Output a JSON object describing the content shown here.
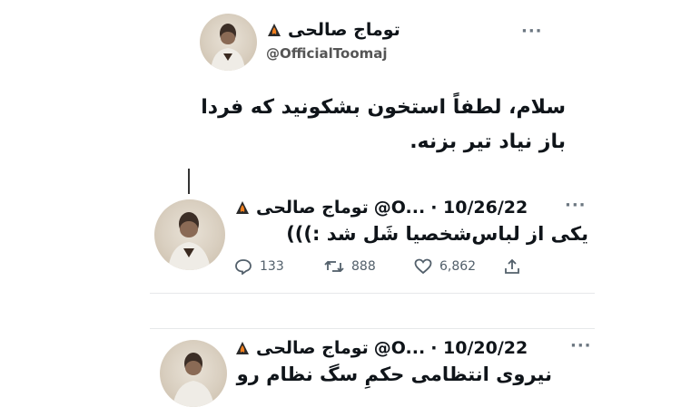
{
  "main_tweet": {
    "author_name": "توماج صالحی",
    "handle": "@OfficialToomaj",
    "text_line1": "سلام، لطفاً استخون بشکونید که فردا",
    "text_line2": "باز نیاد تیر بزنه.",
    "more_label": "···"
  },
  "reply1": {
    "author_name": "توماج صالحی",
    "handle": "@O...",
    "date": "· 10/26/22",
    "more_label": "···",
    "text": "یکی از لباس‌شخصیا شَل شد :)))",
    "stats": {
      "replies": "133",
      "retweets": "888",
      "likes": "6,862"
    }
  },
  "reply2": {
    "author_name": "توماج صالحی",
    "handle": "@O...",
    "date": "· 10/20/22",
    "more_label": "···",
    "text": "نیروی انتظامی حکمِ سگ نظام رو"
  },
  "icons": [
    "fire-icon",
    "reply-icon",
    "retweet-icon",
    "like-icon",
    "share-icon",
    "more-icon"
  ],
  "colors": {
    "text": "#0f1419",
    "secondary": "#53606b",
    "divider": "#e6e8ea"
  }
}
